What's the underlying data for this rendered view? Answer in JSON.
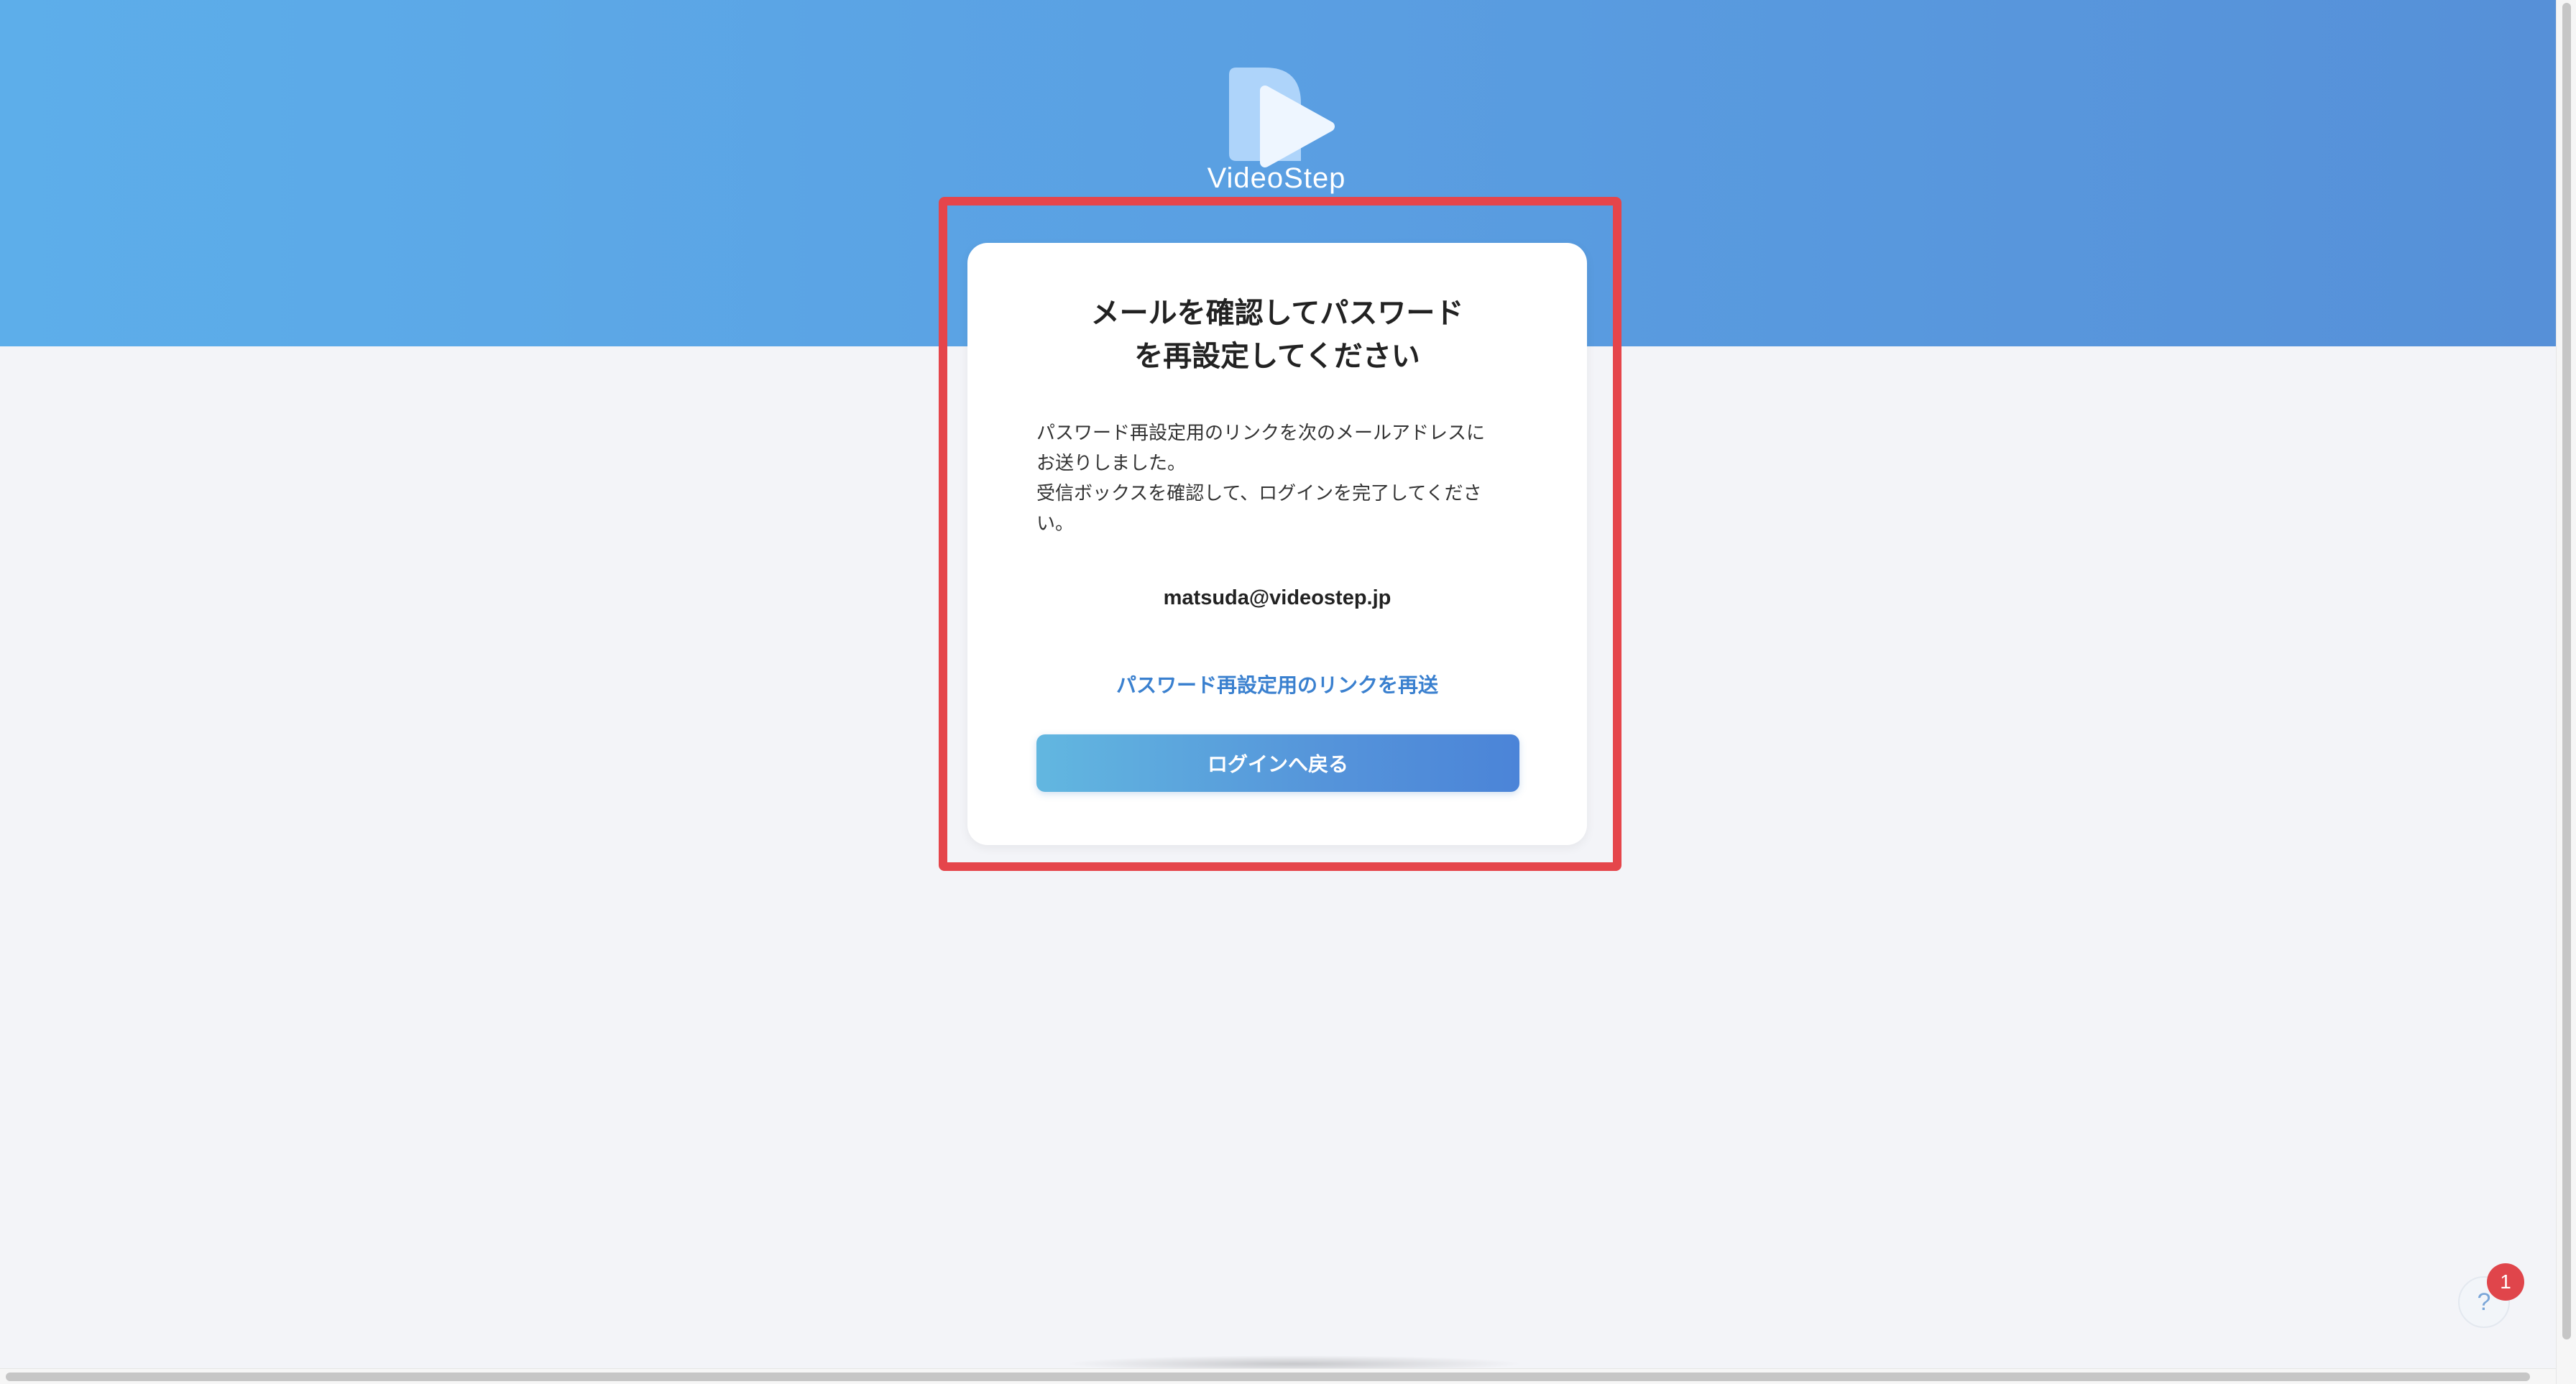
{
  "brand": {
    "name": "VideoStep",
    "logo_icon": "play-icon"
  },
  "card": {
    "title": "メールを確認してパスワード\nを再設定してください",
    "body": "パスワード再設定用のリンクを次のメールアドレスに\nお送りしました。\n受信ボックスを確認して、ログインを完了してくださ\nい。",
    "email": "matsuda@videostep.jp",
    "resend_link": "パスワード再設定用のリンクを再送",
    "back_button": "ログインへ戻る"
  },
  "help": {
    "icon_label": "?",
    "badge_count": "1"
  },
  "colors": {
    "accent": "#5aa3e4",
    "link": "#3a80cf",
    "highlight": "#e5454b",
    "badge": "#e0454b",
    "background": "#f3f4f8"
  }
}
